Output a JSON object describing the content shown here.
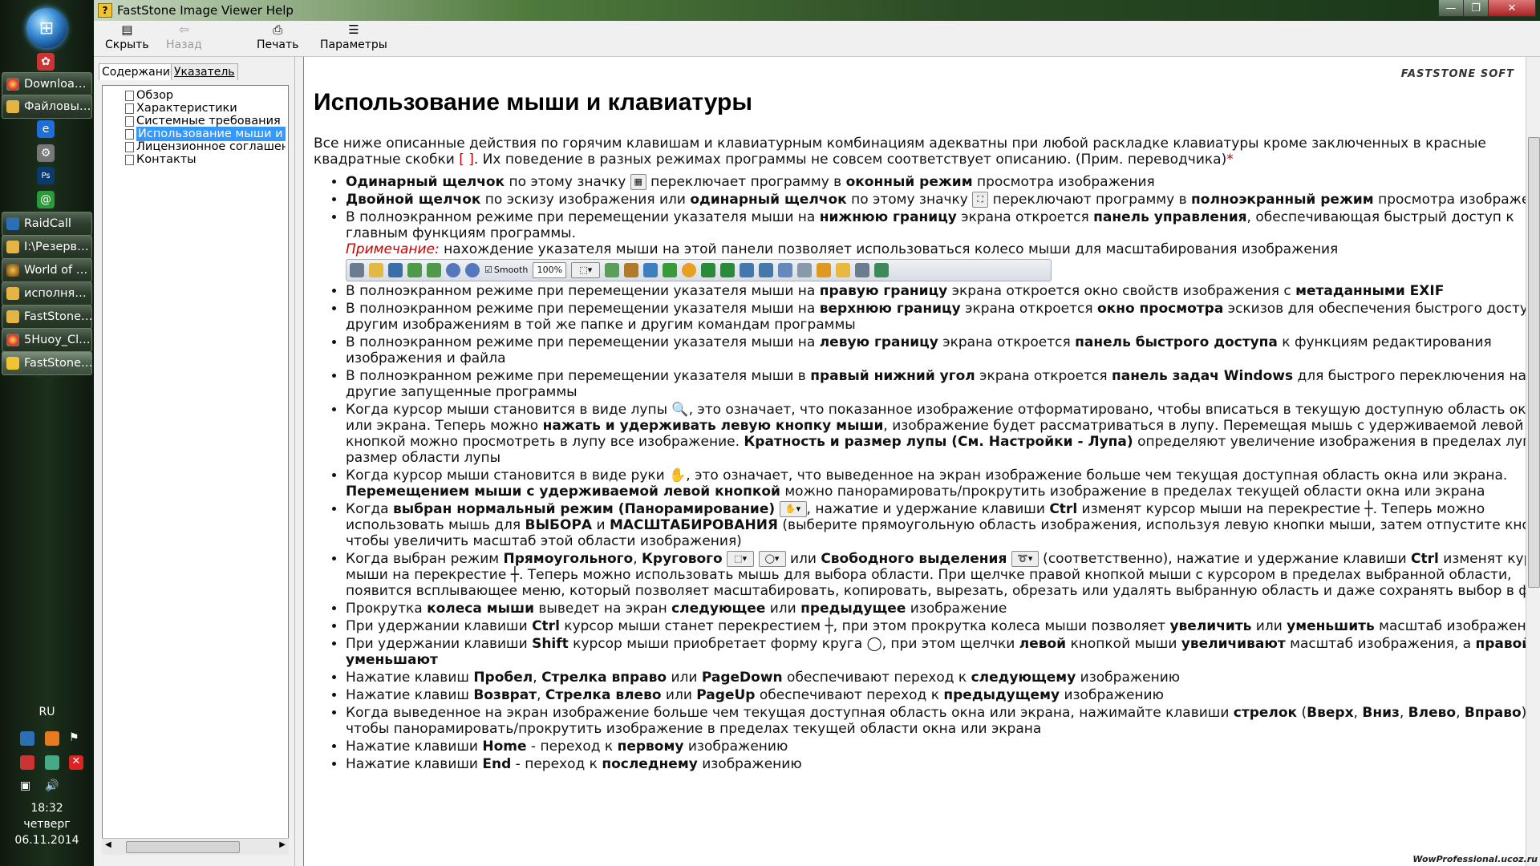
{
  "taskbar": {
    "buttons": [
      "Downloa…",
      "Файловы…",
      "RaidCall",
      "I:\\Резерв…",
      "World of …",
      "исполня…",
      "FastStone…",
      "5Huoy_Cl…",
      "FastStone…"
    ],
    "language": "RU",
    "time": "18:32",
    "day": "четверг",
    "date": "06.11.2014"
  },
  "window": {
    "title": "FastStone Image Viewer Help",
    "controls": {
      "minimize": "—",
      "maximize": "❐",
      "close": "✕"
    }
  },
  "toolbar": {
    "hide_label": "Скрыть",
    "back_label": "Назад",
    "print_label": "Печать",
    "options_label": "Параметры"
  },
  "nav": {
    "tab_contents": "Содержание",
    "tab_index": "Указатель",
    "items": [
      "Обзор",
      "Характеристики",
      "Системные требования",
      "Использование мыши и кл",
      "Лицензионное соглашение",
      "Контакты"
    ],
    "selected_index": 3
  },
  "content": {
    "brand": "FASTSTONE SOFT",
    "title": "Использование мыши и клавиатуры",
    "intro_1": "Все ниже описанные действия по горячим клавишам и клавиатурным комбинациям адекватны при любой раскладке клавиатуры кроме заключенных в красные квадратные скобки ",
    "intro_brackets": "[ ]",
    "intro_2": ". Их поведение в разных режимах программы не совсем соответствует описанию. (Прим. переводчика)",
    "intro_star": "*",
    "note_label": "Примечание:",
    "note_text": " нахождение указателя мыши на этой панели позволяет использоваться колесо мыши для масштабирования изображения",
    "fs_toolbar": {
      "smooth": "Smooth",
      "zoom": "100%"
    },
    "watermark": "WowProfessional.ucoz.ru"
  },
  "colors": {
    "accent_selection": "#3399ff",
    "note_red": "#cc0000"
  }
}
